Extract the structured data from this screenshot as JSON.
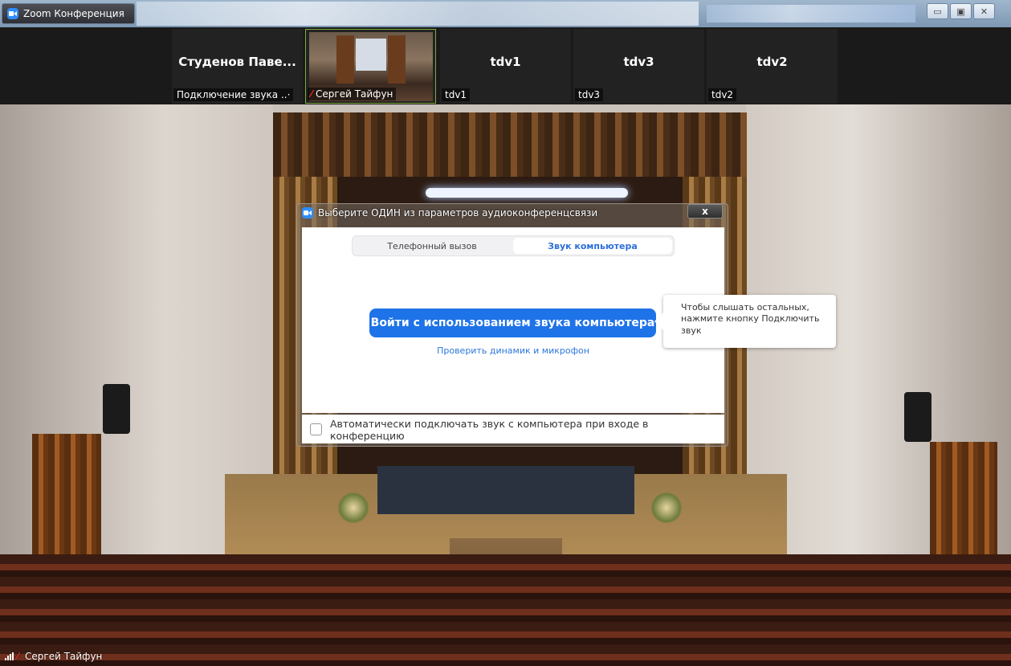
{
  "window": {
    "title": "Zoom Конференция",
    "controls": {
      "minimize": "▭",
      "maximize": "▣",
      "close": "✕"
    }
  },
  "participants": [
    {
      "display_name": "Студенов Паве...",
      "label": "Подключение звука ..·"
    },
    {
      "display_name": "",
      "label": "Сергей Тайфун",
      "muted": true,
      "has_video": true
    },
    {
      "display_name": "tdv1",
      "label": "tdv1"
    },
    {
      "display_name": "tdv3",
      "label": "tdv3"
    },
    {
      "display_name": "tdv2",
      "label": "tdv2"
    }
  ],
  "dialog": {
    "title": "Выберите ОДИН из параметров аудиоконференцсвязи",
    "close_label": "x",
    "tabs": [
      {
        "label": "Телефонный вызов",
        "selected": false
      },
      {
        "label": "Звук компьютера",
        "selected": true
      }
    ],
    "join_button": "Войти с использованием звука компьютера",
    "test_link": "Проверить динамик и микрофон",
    "auto_join_label": "Автоматически подключать звук с компьютера при входе в конференцию",
    "auto_join_checked": false
  },
  "tooltip": {
    "text_lines": [
      "Чтобы слышать остальных,",
      "нажмите кнопку Подключить",
      "звук"
    ]
  },
  "status": {
    "speaker_name": "Сергей Тайфун"
  },
  "colors": {
    "accent": "#1e73e8",
    "link": "#2f77d9",
    "muted_mic": "#e33333",
    "active_tile_border": "#7fa93b"
  }
}
